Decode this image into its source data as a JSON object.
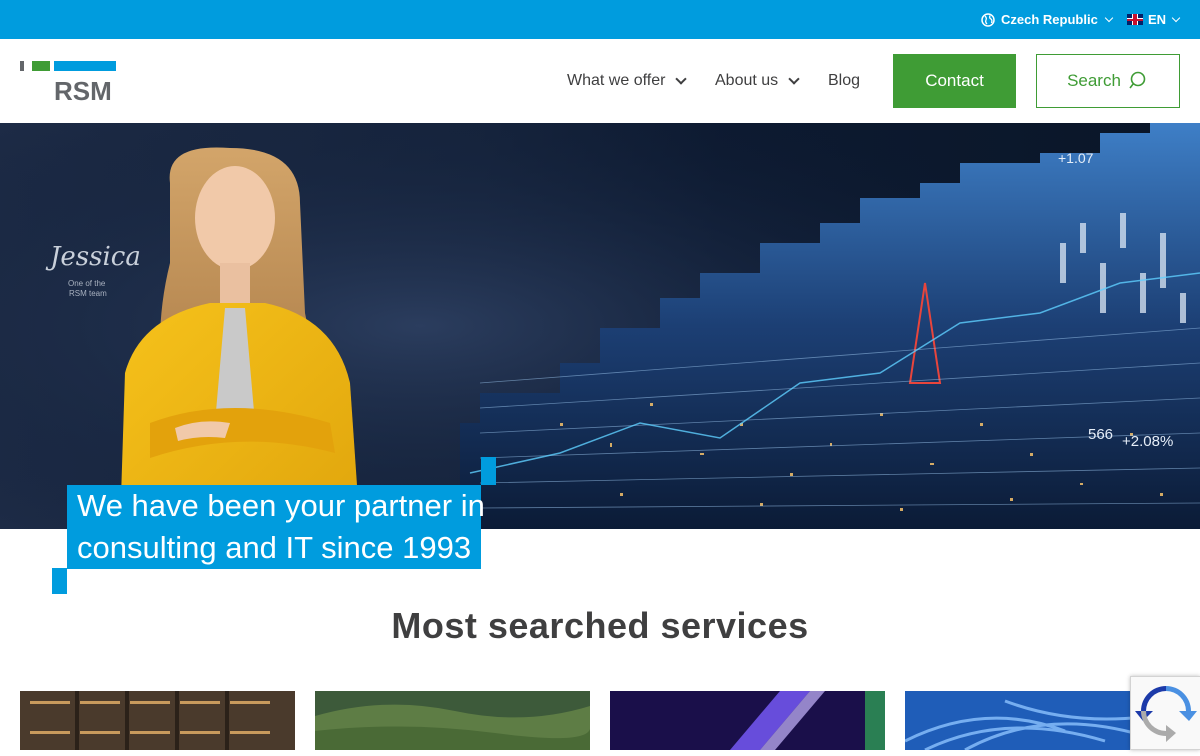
{
  "topbar": {
    "region_label": "Czech Republic",
    "language_label": "EN"
  },
  "header": {
    "logo_text": "RSM",
    "nav": {
      "what_we_offer": "What we offer",
      "about_us": "About us",
      "blog": "Blog"
    },
    "contact_label": "Contact",
    "search_label": "Search"
  },
  "hero": {
    "signature": "Jessica",
    "caption_line1": "One of the",
    "caption_line2": "RSM team",
    "headline_line1": "We have been your partner in",
    "headline_line2": "consulting and IT since 1993",
    "ticker_1": "+1.07",
    "ticker_2": "566",
    "ticker_3": "+2.08%"
  },
  "services": {
    "title": "Most searched services"
  },
  "colors": {
    "brand_blue": "#009cde",
    "brand_green": "#3f9c35",
    "text_grey": "#3f3f40"
  },
  "icons": {
    "globe": "globe-icon",
    "flag": "uk-flag-icon",
    "search": "search-icon",
    "chevron": "chevron-down-icon",
    "recaptcha": "recaptcha-icon"
  }
}
